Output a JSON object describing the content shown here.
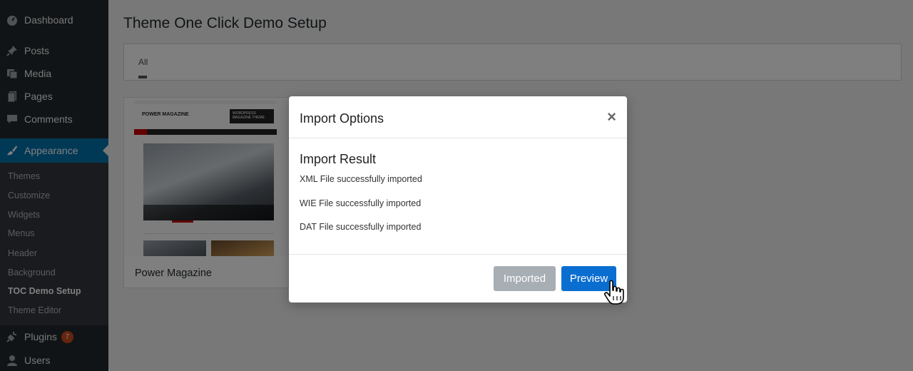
{
  "sidebar": {
    "items": [
      {
        "label": "Dashboard",
        "icon": "dashboard-icon"
      },
      {
        "label": "Posts",
        "icon": "pin-icon"
      },
      {
        "label": "Media",
        "icon": "media-icon"
      },
      {
        "label": "Pages",
        "icon": "pages-icon"
      },
      {
        "label": "Comments",
        "icon": "comments-icon"
      },
      {
        "label": "Appearance",
        "icon": "brush-icon"
      },
      {
        "label": "Plugins",
        "icon": "plug-icon",
        "badge": "7"
      },
      {
        "label": "Users",
        "icon": "user-icon"
      }
    ],
    "submenu": [
      "Themes",
      "Customize",
      "Widgets",
      "Menus",
      "Header",
      "Background",
      "TOC Demo Setup",
      "Theme Editor"
    ]
  },
  "main": {
    "title": "Theme One Click Demo Setup",
    "filter_tab": "All",
    "theme_card": {
      "name": "Power Magazine",
      "shot_logo": "POWER MAGAZINE",
      "shot_banner": "WORDPRESS MAGAZINE THEME"
    }
  },
  "modal": {
    "title": "Import Options",
    "close": "×",
    "result_title": "Import Result",
    "lines": [
      "XML File successfully imported",
      "WIE File successfully imported",
      "DAT File successfully imported"
    ],
    "imported_label": "Imported",
    "preview_label": "Preview"
  },
  "colors": {
    "sidebar_bg": "#23282d",
    "active": "#0073aa",
    "preview_button": "#0a6ed1",
    "imported_button": "#a7aeb4",
    "badge": "#ca4a1f"
  }
}
